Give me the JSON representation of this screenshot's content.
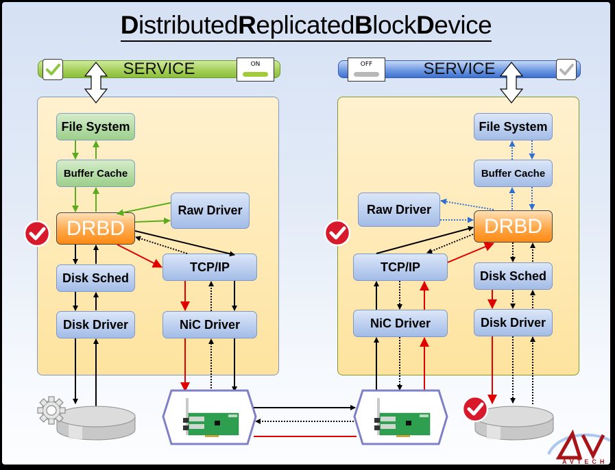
{
  "title": {
    "parts": [
      {
        "bold": "D",
        "rest": "istributed "
      },
      {
        "bold": "R",
        "rest": "eplicated "
      },
      {
        "bold": "B",
        "rest": "lock "
      },
      {
        "bold": "D",
        "rest": "evice"
      }
    ]
  },
  "left_node": {
    "service_label": "SERVICE",
    "service_state": "ON",
    "service_checked": true,
    "boxes": {
      "file_system": "File System",
      "buffer_cache": "Buffer Cache",
      "raw_driver": "Raw Driver",
      "drbd": "DRBD",
      "disk_sched": "Disk Sched",
      "disk_driver": "Disk Driver",
      "tcp_ip": "TCP/IP",
      "nic_driver": "NiC Driver"
    },
    "status": "active"
  },
  "right_node": {
    "service_label": "SERVICE",
    "service_state": "OFF",
    "service_checked": false,
    "boxes": {
      "file_system": "File System",
      "buffer_cache": "Buffer Cache",
      "raw_driver": "Raw Driver",
      "drbd": "DRBD",
      "disk_sched": "Disk Sched",
      "disk_driver": "Disk Driver",
      "tcp_ip": "TCP/IP",
      "nic_driver": "NiC Driver"
    },
    "status": "standby"
  },
  "colors": {
    "active_path": "#5aac1e",
    "standby_path": "#2f6fd1",
    "replication": "#e00000",
    "control": "#000000",
    "nic_frame": "#7f7fc7"
  },
  "logo": {
    "text": "AVTECH",
    "mark": "AV"
  }
}
